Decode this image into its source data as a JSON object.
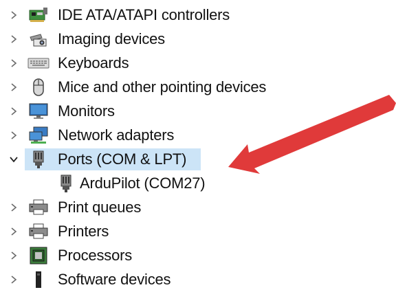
{
  "tree": {
    "items": [
      {
        "label": "IDE ATA/ATAPI controllers",
        "icon": "ide-controller-icon",
        "expanded": false
      },
      {
        "label": "Imaging devices",
        "icon": "camera-icon",
        "expanded": false
      },
      {
        "label": "Keyboards",
        "icon": "keyboard-icon",
        "expanded": false
      },
      {
        "label": "Mice and other pointing devices",
        "icon": "mouse-icon",
        "expanded": false
      },
      {
        "label": "Monitors",
        "icon": "monitor-icon",
        "expanded": false
      },
      {
        "label": "Network adapters",
        "icon": "network-adapter-icon",
        "expanded": false
      },
      {
        "label": "Ports (COM & LPT)",
        "icon": "port-icon",
        "expanded": true,
        "selected": true,
        "children": [
          {
            "label": "ArduPilot (COM27)",
            "icon": "port-icon"
          }
        ]
      },
      {
        "label": "Print queues",
        "icon": "printer-icon",
        "expanded": false
      },
      {
        "label": "Printers",
        "icon": "printer-icon",
        "expanded": false
      },
      {
        "label": "Processors",
        "icon": "processor-icon",
        "expanded": false
      },
      {
        "label": "Software devices",
        "icon": "software-device-icon",
        "expanded": false
      }
    ]
  },
  "colors": {
    "selection": "#cce4f7",
    "arrow": "#e03a3a",
    "chevron": "#6b6b6b"
  },
  "annotation": {
    "icon": "red-arrow-icon"
  }
}
